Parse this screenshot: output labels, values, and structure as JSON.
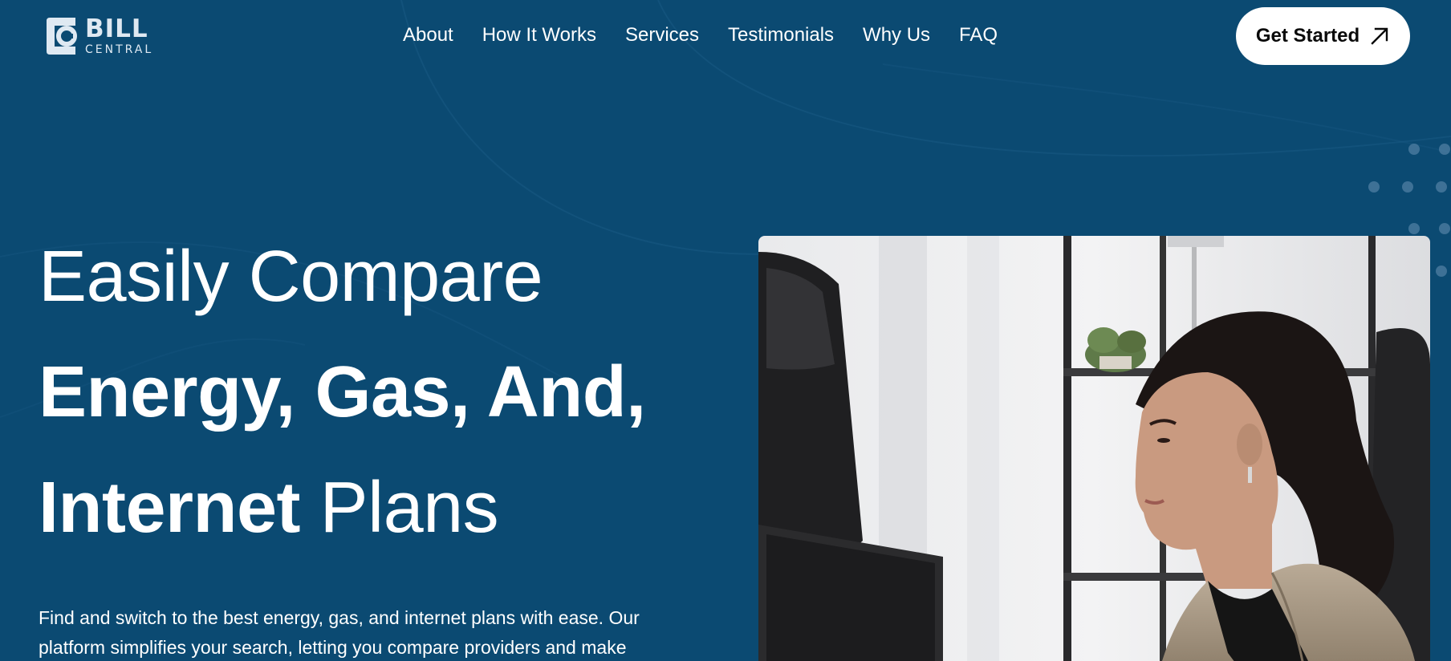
{
  "brand": {
    "name_line1": "BILL",
    "name_line2": "CENTRAL"
  },
  "nav": {
    "items": [
      {
        "label": "About"
      },
      {
        "label": "How It Works"
      },
      {
        "label": "Services"
      },
      {
        "label": "Testimonials"
      },
      {
        "label": "Why Us"
      },
      {
        "label": "FAQ"
      }
    ]
  },
  "cta": {
    "label": "Get Started",
    "icon": "arrow-up-right-icon"
  },
  "hero": {
    "title_line1": "Easily Compare",
    "title_line2": "Energy, Gas, And,",
    "title_line3_bold": "Internet",
    "title_line3_regular": "Plans",
    "description": "Find and switch to the best energy, gas, and internet plans with ease. Our platform simplifies your search, letting you compare providers and make"
  },
  "colors": {
    "background": "#0b4a72",
    "cta_background": "#ffffff",
    "text": "#ffffff"
  }
}
